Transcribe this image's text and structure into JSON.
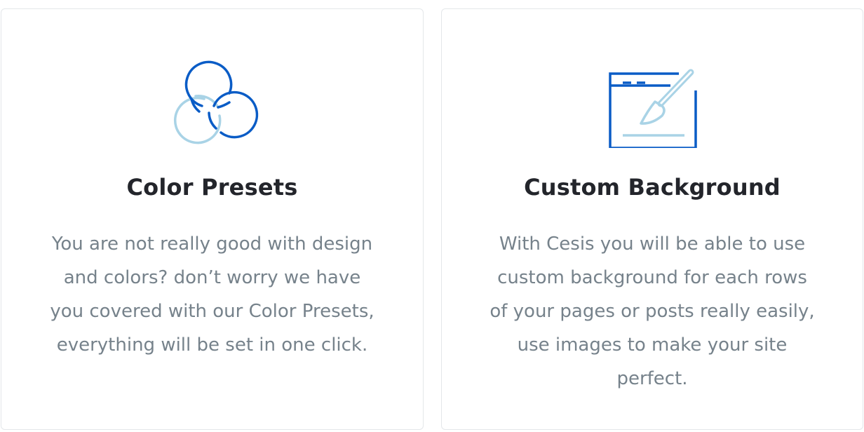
{
  "colors": {
    "primary_blue": "#0a5cc6",
    "light_blue": "#a9d3e6",
    "title": "#23252b",
    "body_text": "#76828b",
    "card_border": "#e4e7ea"
  },
  "cards": [
    {
      "icon": "color-presets-circles-icon",
      "title": "Color Presets",
      "description_lines": [
        "You are not really good with design",
        "and colors? don’t worry we have",
        "you covered with our Color Presets,",
        "everything will be set in one click."
      ]
    },
    {
      "icon": "browser-paintbrush-icon",
      "title": "Custom Background",
      "description_lines": [
        "With Cesis you will be able to use",
        "custom background for each rows",
        "of your pages or posts really easily,",
        "use images to make your site",
        "perfect."
      ]
    }
  ]
}
